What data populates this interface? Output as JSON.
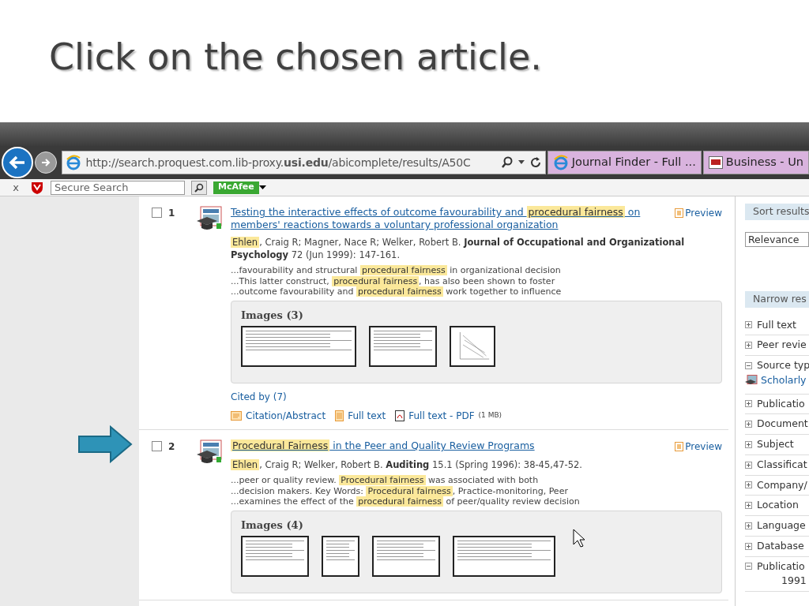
{
  "slide_title": "Click on the chosen article.",
  "browser": {
    "url": "http://search.proquest.com.lib-proxy.**usi.edu**/abicomplete/results/A50C",
    "tabs": [
      {
        "label": "Journal Finder - Full ...",
        "kind": "ie",
        "selected": false
      },
      {
        "label": "Business - Un",
        "kind": "site",
        "selected": false
      }
    ],
    "toolbar": {
      "close": "x",
      "search_placeholder": "Secure Search",
      "badge": "McAfee"
    }
  },
  "results": [
    {
      "number": "1",
      "checked": false,
      "preview": "Preview",
      "title": [
        {
          "text": "Testing the interactive effects of outcome favourability and ",
          "kind": "plain"
        },
        {
          "text": "procedural fairness",
          "kind": "highlight"
        },
        {
          "text": " on members' reactions towards a voluntary professional organization",
          "kind": "plain"
        }
      ],
      "citation": [
        {
          "text": "Ehlen",
          "kind": "highlight"
        },
        {
          "text": ", Craig R; Magner, Nace R; Welker, Robert B. ",
          "kind": "plain"
        },
        {
          "text": "Journal of Occupational and Organizational Psychology",
          "kind": "bold"
        },
        {
          "text": " 72  (Jun 1999): 147-161.",
          "kind": "plain"
        }
      ],
      "snippets": [
        [
          {
            "text": "...favourability and structural ",
            "kind": "plain"
          },
          {
            "text": "procedural fairness",
            "kind": "highlight"
          },
          {
            "text": " in organizational decision",
            "kind": "plain"
          }
        ],
        [
          {
            "text": "...This latter construct, ",
            "kind": "plain"
          },
          {
            "text": "procedural fairness",
            "kind": "highlight"
          },
          {
            "text": ", has also been shown to foster",
            "kind": "plain"
          }
        ],
        [
          {
            "text": "...outcome favourability and ",
            "kind": "plain"
          },
          {
            "text": "procedural fairness",
            "kind": "highlight"
          },
          {
            "text": " work together to influence",
            "kind": "plain"
          }
        ]
      ],
      "images_label": "Images (3)",
      "thumbnails": [
        {
          "kind": "wide"
        },
        {
          "kind": "medium"
        },
        {
          "kind": "graph"
        }
      ],
      "cited_by": "Cited by (7)",
      "links": [
        {
          "label": "Citation/Abstract",
          "kind": "abstract"
        },
        {
          "label": "Full text",
          "kind": "text"
        },
        {
          "label": "Full text - PDF",
          "kind": "pdf",
          "size": "(1 MB)"
        }
      ]
    },
    {
      "number": "2",
      "checked": false,
      "preview": "Preview",
      "title": [
        {
          "text": "Procedural Fairness",
          "kind": "highlight"
        },
        {
          "text": " in the Peer and Quality Review Programs",
          "kind": "plain"
        }
      ],
      "citation": [
        {
          "text": "Ehlen",
          "kind": "highlight"
        },
        {
          "text": ", Craig R; Welker, Robert B. ",
          "kind": "plain"
        },
        {
          "text": "Auditing",
          "kind": "bold"
        },
        {
          "text": " 15.1  (Spring 1996): 38-45,47-52.",
          "kind": "plain"
        }
      ],
      "snippets": [
        [
          {
            "text": "...peer or quality review. ",
            "kind": "plain"
          },
          {
            "text": "Procedural fairness",
            "kind": "highlight"
          },
          {
            "text": " was associated with both",
            "kind": "plain"
          }
        ],
        [
          {
            "text": "...decision makers. Key Words: ",
            "kind": "plain"
          },
          {
            "text": "Procedural fairness",
            "kind": "highlight"
          },
          {
            "text": ", Practice-monitoring, Peer",
            "kind": "plain"
          }
        ],
        [
          {
            "text": "...examines the effect of the ",
            "kind": "plain"
          },
          {
            "text": "procedural fairness",
            "kind": "highlight"
          },
          {
            "text": " of peer/quality review decision",
            "kind": "plain"
          }
        ]
      ],
      "images_label": "Images (4)",
      "thumbnails": [
        {
          "kind": "medium"
        },
        {
          "kind": "narrow"
        },
        {
          "kind": "medium"
        },
        {
          "kind": "large"
        }
      ]
    }
  ],
  "sidebar": {
    "sort_header": "Sort results",
    "sort_value": "Relevance",
    "narrow_header": "Narrow res",
    "facets": [
      {
        "label": "Full text",
        "expanded": false
      },
      {
        "label": "Peer revie",
        "expanded": false
      },
      {
        "label": "Source typ",
        "expanded": true,
        "children": [
          {
            "label": "Scholarly",
            "kind": "icon-link"
          }
        ]
      },
      {
        "label": "Publicatio",
        "expanded": false
      },
      {
        "label": "Document",
        "expanded": false
      },
      {
        "label": "Subject",
        "expanded": false
      },
      {
        "label": "Classificat",
        "expanded": false
      },
      {
        "label": "Company/",
        "expanded": false
      },
      {
        "label": "Location",
        "expanded": false
      },
      {
        "label": "Language",
        "expanded": false
      },
      {
        "label": "Database",
        "expanded": false
      },
      {
        "label": "Publicatio",
        "expanded": true,
        "children": [
          {
            "label": "1991",
            "kind": "value"
          }
        ]
      }
    ]
  }
}
